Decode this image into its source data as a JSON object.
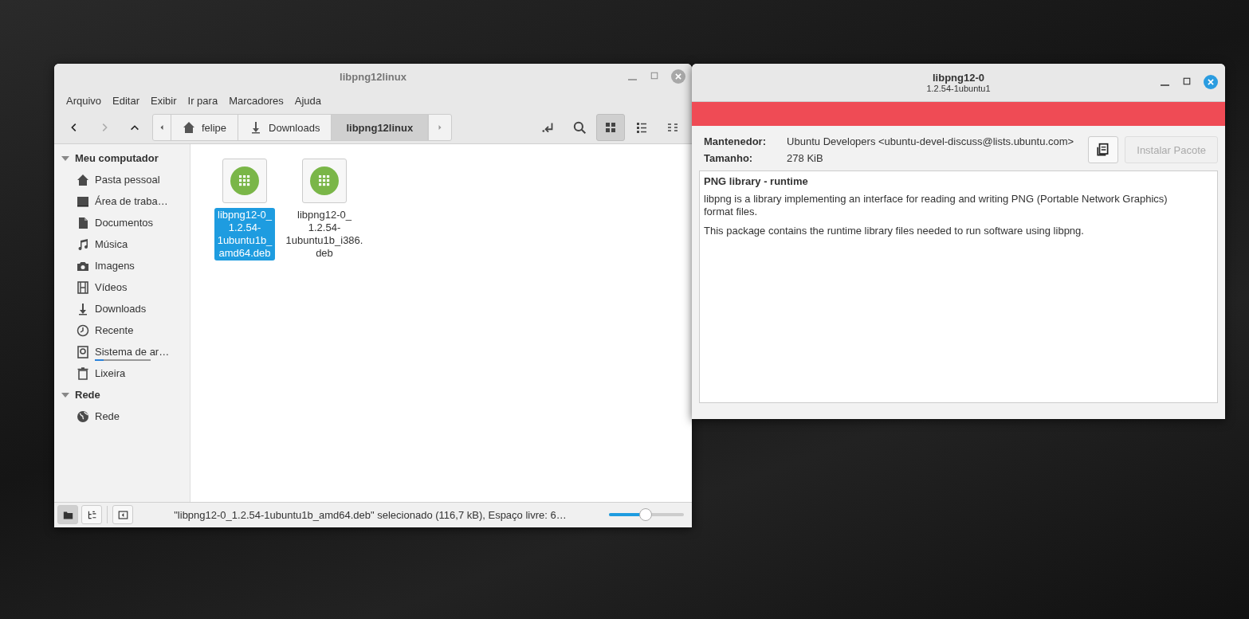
{
  "file_manager": {
    "title": "libpng12linux",
    "active": false,
    "menu": [
      "Arquivo",
      "Editar",
      "Exibir",
      "Ir para",
      "Marcadores",
      "Ajuda"
    ],
    "nav_buttons": [
      {
        "disabled": false
      },
      {
        "disabled": true
      },
      {
        "disabled": false
      }
    ],
    "breadcrumb": [
      {
        "label": "felipe",
        "selected": false
      },
      {
        "label": "Downloads",
        "selected": false
      },
      {
        "label": "libpng12linux",
        "selected": true
      }
    ],
    "view_buttons": [
      {
        "selected": true
      },
      {
        "selected": false
      },
      {
        "selected": false
      }
    ],
    "sidebar": [
      {
        "title": "Meu computador",
        "expanded": true,
        "items": [
          {
            "label": "Pasta pessoal"
          },
          {
            "label": "Área de traba…"
          },
          {
            "label": "Documentos"
          },
          {
            "label": "Música"
          },
          {
            "label": "Imagens"
          },
          {
            "label": "Vídeos"
          },
          {
            "label": "Downloads"
          },
          {
            "label": "Recente"
          },
          {
            "label": "Sistema de ar…",
            "level": 0.15
          },
          {
            "label": "Lixeira"
          }
        ]
      },
      {
        "title": "Rede",
        "expanded": true,
        "items": [
          {
            "label": "Rede"
          }
        ]
      }
    ],
    "files": [
      {
        "name": "libpng12-0_\n1.2.54-\n1ubuntu1b_\namd64.deb",
        "selected": true
      },
      {
        "name": "libpng12-0_\n1.2.54-\n1ubuntu1b_i386.\ndeb",
        "selected": false
      }
    ],
    "status_buttons": [
      {
        "selected": true
      },
      {
        "selected": false
      }
    ],
    "status_text": "\"libpng12-0_1.2.54-1ubuntu1b_amd64.deb\" selecionado (116,7 kB), Espaço livre: 6…",
    "zoom": {
      "level": 0.49
    }
  },
  "package_window": {
    "title": "libpng12-0",
    "subtitle": "1.2.54-1ubuntu1",
    "active": true,
    "fields": [
      {
        "label": "Mantenedor:",
        "value": "Ubuntu Developers <ubuntu-devel-discuss@lists.ubuntu.com>"
      },
      {
        "label": "Tamanho:",
        "value": "278 KiB"
      }
    ],
    "install_button": {
      "label": "Instalar Pacote",
      "disabled": true
    },
    "description": {
      "heading": "PNG library - runtime",
      "paragraphs": [
        "libpng is a library implementing an interface for reading and writing PNG (Portable Network Graphics) format files.",
        "This package contains the runtime library files needed to run software using libpng."
      ]
    }
  }
}
